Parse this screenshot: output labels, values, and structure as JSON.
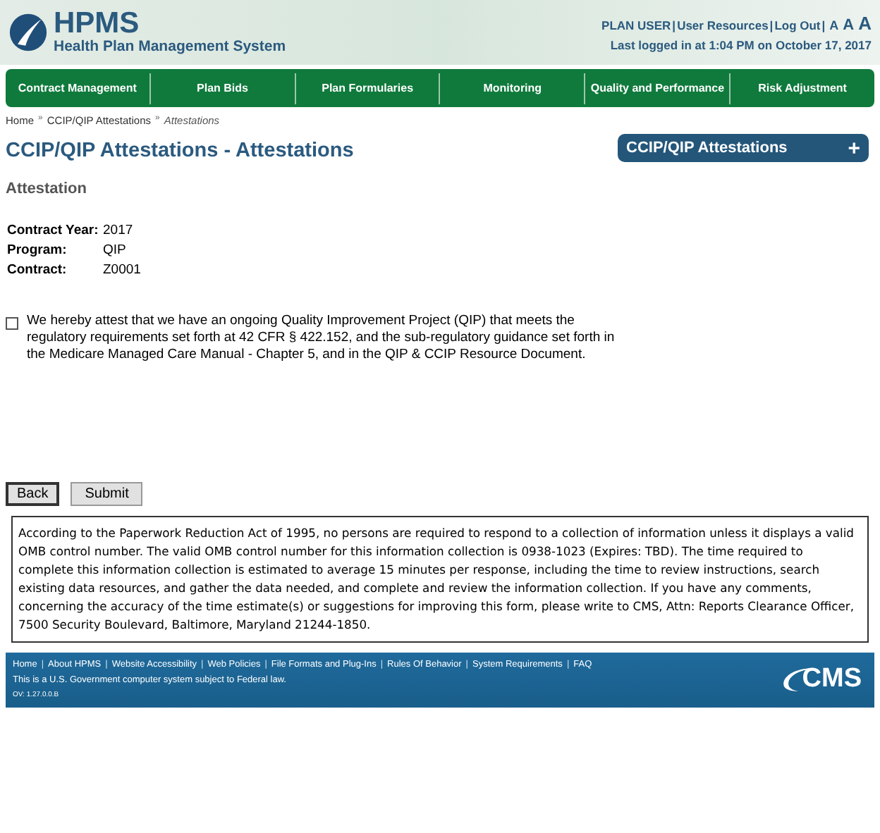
{
  "header": {
    "logo_title": "HPMS",
    "logo_subtitle": "Health Plan Management System",
    "user_links": [
      {
        "kind": "link",
        "text": "PLAN USER"
      },
      {
        "kind": "sep",
        "text": "|"
      },
      {
        "kind": "link",
        "text": "User Resources"
      },
      {
        "kind": "sep",
        "text": "|"
      },
      {
        "kind": "link",
        "text": "Log Out"
      },
      {
        "kind": "sep",
        "text": "|"
      },
      {
        "kind": "size",
        "text": "A"
      },
      {
        "kind": "size",
        "text": "A"
      },
      {
        "kind": "size",
        "text": "A"
      }
    ],
    "last_login": "Last logged in at 1:04 PM on October 17, 2017"
  },
  "nav": [
    "Contract Management",
    "Plan Bids",
    "Plan Formularies",
    "Monitoring",
    "Quality and Performance",
    "Risk Adjustment"
  ],
  "breadcrumb": [
    {
      "kind": "link",
      "text": "Home",
      "current": false
    },
    {
      "kind": "sep",
      "text": "»"
    },
    {
      "kind": "link",
      "text": "CCIP/QIP Attestations",
      "current": false
    },
    {
      "kind": "sep",
      "text": "»"
    },
    {
      "kind": "link",
      "text": "Attestations",
      "current": true
    }
  ],
  "page_title": "CCIP/QIP Attestations - Attestations",
  "side_panel": {
    "title": "CCIP/QIP Attestations",
    "expanded": false,
    "toggle": "+"
  },
  "section_title": "Attestation",
  "fields": [
    {
      "label": "Contract Year:",
      "value": "2017"
    },
    {
      "label": "Program:",
      "value": "QIP"
    },
    {
      "label": "Contract:",
      "value": "Z0001"
    }
  ],
  "attestation": {
    "checked": false,
    "text": "We hereby attest that we have an ongoing Quality Improvement Project (QIP) that meets the regulatory requirements set forth at 42 CFR § 422.152, and the sub-regulatory guidance set forth in the Medicare Managed Care Manual - Chapter 5, and in the QIP & CCIP Resource Document."
  },
  "buttons": [
    "Back",
    "Submit"
  ],
  "notice": "According to the Paperwork Reduction Act of 1995, no persons are required to respond to a collection of information unless it displays a valid OMB control number. The valid OMB control number for this information collection is 0938-1023 (Expires: TBD). The time required to complete this information collection is estimated to average 15 minutes per response, including the time to review instructions, search existing data resources, and gather the data needed, and complete and review the information collection. If you have any comments, concerning the accuracy of the time estimate(s) or suggestions for improving this form, please write to CMS, Attn: Reports Clearance Officer, 7500 Security Boulevard, Baltimore, Maryland 21244-1850.",
  "footer": {
    "links": [
      {
        "kind": "link",
        "text": "Home"
      },
      {
        "kind": "sep",
        "text": "|"
      },
      {
        "kind": "link",
        "text": "About HPMS"
      },
      {
        "kind": "sep",
        "text": "|"
      },
      {
        "kind": "link",
        "text": "Website Accessibility"
      },
      {
        "kind": "sep",
        "text": "|"
      },
      {
        "kind": "link",
        "text": "Web Policies"
      },
      {
        "kind": "sep",
        "text": "|"
      },
      {
        "kind": "link",
        "text": "File Formats and Plug-Ins"
      },
      {
        "kind": "sep",
        "text": "|"
      },
      {
        "kind": "link",
        "text": "Rules Of Behavior"
      },
      {
        "kind": "sep",
        "text": "|"
      },
      {
        "kind": "link",
        "text": "System Requirements"
      },
      {
        "kind": "sep",
        "text": "|"
      },
      {
        "kind": "link",
        "text": "FAQ"
      }
    ],
    "notice": "This is a U.S. Government computer system subject to Federal law.",
    "version": "OV: 1.27.0.0.B",
    "logo": "CMS"
  }
}
